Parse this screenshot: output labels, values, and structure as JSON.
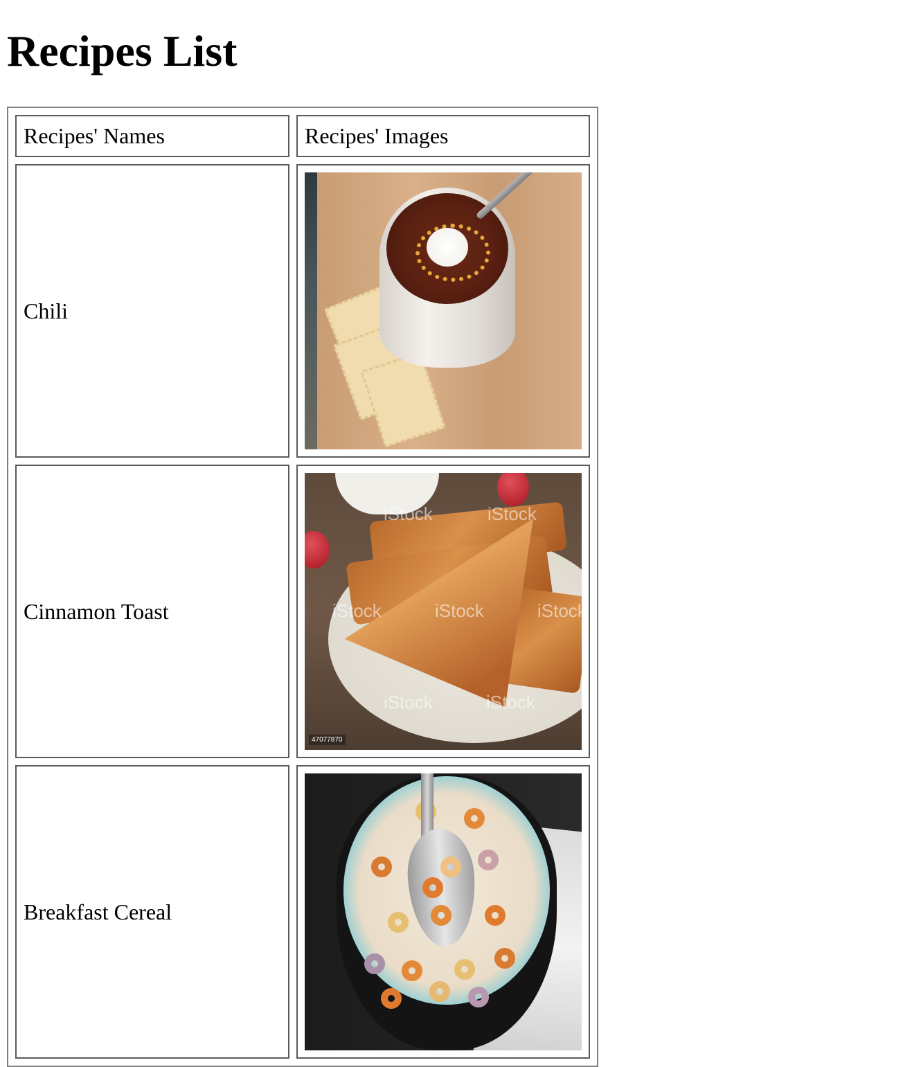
{
  "page": {
    "title": "Recipes List"
  },
  "table": {
    "headers": [
      "Recipes' Names",
      "Recipes' Images"
    ],
    "rows": [
      {
        "name": "Chili",
        "image": "chili-bowl-photo"
      },
      {
        "name": "Cinnamon Toast",
        "image": "cinnamon-toast-photo"
      },
      {
        "name": "Breakfast Cereal",
        "image": "cereal-bowl-photo"
      }
    ]
  },
  "toast_photo": {
    "watermark": "iStock",
    "id_tag": "47077870"
  }
}
